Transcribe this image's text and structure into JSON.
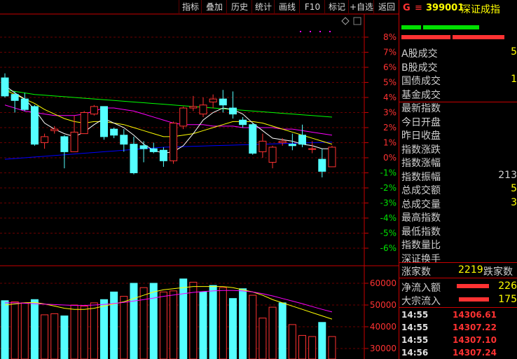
{
  "toolbar": {
    "buttons": [
      "指标",
      "叠加",
      "历史",
      "统计",
      "画线",
      "F10",
      "标记",
      "+自选",
      "返回"
    ]
  },
  "price_panel": {
    "y_ticks": [
      "8%",
      "7%",
      "6%",
      "5%",
      "4%",
      "3%",
      "2%",
      "1%",
      "0%",
      "-1%",
      "-2%",
      "-3%",
      "-4%",
      "-5%",
      "-6%"
    ],
    "colors": {
      "up": "#ff3232",
      "down": "#54ffff",
      "ma5": "#ffffff",
      "ma10": "#ffff00",
      "ma20": "#ff00ff",
      "ma60": "#00ff00",
      "ma120": "#0000ff",
      "axis": "#c80000"
    },
    "candles": [
      {
        "o": 5.3,
        "c": 4.1,
        "h": 5.6,
        "l": 4.0
      },
      {
        "o": 4.2,
        "c": 3.8,
        "h": 4.4,
        "l": 3.0
      },
      {
        "o": 3.9,
        "c": 3.2,
        "h": 4.3,
        "l": 3.1
      },
      {
        "o": 3.4,
        "c": 0.9,
        "h": 3.5,
        "l": 0.8
      },
      {
        "o": 1.0,
        "c": 1.4,
        "h": 1.6,
        "l": 0.6
      },
      {
        "o": 1.8,
        "c": 1.9,
        "h": 2.1,
        "l": 1.6
      },
      {
        "o": 1.4,
        "c": 0.4,
        "h": 1.5,
        "l": -0.7
      },
      {
        "o": 0.4,
        "c": 1.7,
        "h": 2.8,
        "l": 0.4
      },
      {
        "o": 1.6,
        "c": 3.0,
        "h": 3.1,
        "l": 1.6
      },
      {
        "o": 2.9,
        "c": 3.4,
        "h": 3.5,
        "l": 2.8
      },
      {
        "o": 3.4,
        "c": 1.4,
        "h": 3.4,
        "l": 1.2
      },
      {
        "o": 1.9,
        "c": 1.5,
        "h": 2.0,
        "l": 1.3
      },
      {
        "o": 1.5,
        "c": 0.9,
        "h": 1.9,
        "l": 0.4
      },
      {
        "o": 0.9,
        "c": -1.0,
        "h": 1.4,
        "l": -1.1
      },
      {
        "o": 0.8,
        "c": 0.6,
        "h": 1.1,
        "l": -0.3
      },
      {
        "o": 0.6,
        "c": 0.4,
        "h": 1.0,
        "l": 0.3
      },
      {
        "o": 0.5,
        "c": -0.2,
        "h": 0.7,
        "l": -0.6
      },
      {
        "o": -0.2,
        "c": 2.3,
        "h": 2.4,
        "l": -0.4
      },
      {
        "o": 2.1,
        "c": 3.3,
        "h": 3.4,
        "l": 1.9
      },
      {
        "o": 3.3,
        "c": 3.4,
        "h": 4.1,
        "l": 3.1
      },
      {
        "o": 2.9,
        "c": 3.5,
        "h": 4.0,
        "l": 2.7
      },
      {
        "o": 3.7,
        "c": 3.9,
        "h": 4.2,
        "l": 3.3
      },
      {
        "o": 3.9,
        "c": 3.5,
        "h": 4.5,
        "l": 3.0
      },
      {
        "o": 3.3,
        "c": 2.9,
        "h": 4.4,
        "l": 2.6
      },
      {
        "o": 2.5,
        "c": 2.2,
        "h": 2.7,
        "l": 2.0
      },
      {
        "o": 2.2,
        "c": 0.3,
        "h": 2.3,
        "l": 0.2
      },
      {
        "o": 0.4,
        "c": 1.1,
        "h": 1.6,
        "l": 0.0
      },
      {
        "o": -0.3,
        "c": 0.7,
        "h": 0.8,
        "l": -0.7
      },
      {
        "o": 1.0,
        "c": 1.1,
        "h": 1.3,
        "l": 0.8
      },
      {
        "o": 0.9,
        "c": 0.8,
        "h": 1.6,
        "l": 0.5
      },
      {
        "o": 1.5,
        "c": 0.9,
        "h": 2.2,
        "l": 0.7
      },
      {
        "o": 0.6,
        "c": 0.6,
        "h": 1.1,
        "l": 0.3
      },
      {
        "o": -0.1,
        "c": -0.9,
        "h": 0.6,
        "l": -1.3
      },
      {
        "o": -0.6,
        "c": 0.7,
        "h": 0.8,
        "l": -0.6
      }
    ],
    "ma5": [
      4.8,
      4.3,
      3.9,
      3.2,
      2.3,
      1.9,
      1.6,
      1.4,
      1.7,
      2.2,
      2.6,
      2.3,
      2.0,
      1.5,
      0.9,
      0.5,
      0.3,
      0.4,
      0.8,
      1.6,
      2.5,
      3.0,
      3.3,
      3.2,
      2.9,
      2.3,
      1.8,
      1.3,
      1.2,
      1.1,
      0.9,
      0.8,
      0.6,
      0.6
    ],
    "ma10": [
      4.5,
      4.2,
      3.9,
      3.6,
      3.2,
      2.9,
      2.6,
      2.4,
      2.3,
      2.4,
      2.4,
      2.3,
      2.2,
      2.0,
      1.8,
      1.6,
      1.4,
      1.4,
      1.5,
      1.6,
      1.8,
      2.0,
      2.2,
      2.4,
      2.4,
      2.4,
      2.3,
      2.1,
      1.9,
      1.7,
      1.5,
      1.3,
      1.1,
      0.9
    ],
    "ma20": [
      3.5,
      3.3,
      3.1,
      3.0,
      2.9,
      2.8,
      2.8,
      2.8,
      2.9,
      3.1,
      3.3,
      3.3,
      3.2,
      3.1,
      2.9,
      2.7,
      2.5,
      2.3,
      2.2,
      2.2,
      2.2,
      2.1,
      2.1,
      2.1,
      2.0,
      2.0,
      2.0,
      2.0,
      1.9,
      1.9,
      1.8,
      1.7,
      1.6,
      1.5
    ],
    "ma60": [
      4.5,
      4.4,
      4.3,
      4.2,
      4.15,
      4.1,
      4.05,
      4.0,
      3.95,
      3.9,
      3.85,
      3.8,
      3.75,
      3.7,
      3.65,
      3.6,
      3.55,
      3.5,
      3.45,
      3.4,
      3.35,
      3.3,
      3.25,
      3.2,
      3.15,
      3.1,
      3.05,
      3.0,
      2.95,
      2.9,
      2.85,
      2.8,
      2.75,
      2.7
    ],
    "ma120": [
      -0.1,
      -0.05,
      0.0,
      0.05,
      0.1,
      0.15,
      0.2,
      0.25,
      0.3,
      0.35,
      0.4,
      0.45,
      0.5,
      0.55,
      0.6,
      0.65,
      0.7,
      0.72,
      0.74,
      0.76,
      0.78,
      0.8,
      0.82,
      0.84,
      0.86,
      0.88,
      0.9,
      0.92,
      0.94,
      0.96,
      0.98,
      1.0,
      1.02,
      1.04
    ]
  },
  "volume_panel": {
    "y_ticks": [
      "60000",
      "50000",
      "40000",
      "30000"
    ],
    "bars": [
      {
        "v": 52000,
        "up": false
      },
      {
        "v": 51500,
        "up": true
      },
      {
        "v": 51000,
        "up": true
      },
      {
        "v": 52500,
        "up": false
      },
      {
        "v": 45500,
        "up": true
      },
      {
        "v": 46000,
        "up": true
      },
      {
        "v": 45000,
        "up": false
      },
      {
        "v": 50000,
        "up": true
      },
      {
        "v": 49500,
        "up": true
      },
      {
        "v": 51000,
        "up": true
      },
      {
        "v": 52500,
        "up": false
      },
      {
        "v": 56000,
        "up": false
      },
      {
        "v": 54000,
        "up": true
      },
      {
        "v": 60000,
        "up": false
      },
      {
        "v": 58000,
        "up": true
      },
      {
        "v": 60000,
        "up": false
      },
      {
        "v": 56000,
        "up": true
      },
      {
        "v": 56500,
        "up": true
      },
      {
        "v": 62000,
        "up": false
      },
      {
        "v": 60500,
        "up": true
      },
      {
        "v": 56000,
        "up": false
      },
      {
        "v": 59000,
        "up": false
      },
      {
        "v": 58000,
        "up": true
      },
      {
        "v": 53000,
        "up": false
      },
      {
        "v": 57500,
        "up": false
      },
      {
        "v": 54500,
        "up": true
      },
      {
        "v": 44000,
        "up": true
      },
      {
        "v": 49000,
        "up": true
      },
      {
        "v": 51000,
        "up": false
      },
      {
        "v": 41000,
        "up": true
      },
      {
        "v": 36000,
        "up": true
      },
      {
        "v": 35500,
        "up": true
      },
      {
        "v": 42000,
        "up": false
      },
      {
        "v": 35500,
        "up": true
      }
    ],
    "ma5": [
      50000,
      50500,
      51000,
      51200,
      50500,
      49500,
      48500,
      48000,
      48000,
      48500,
      49500,
      50500,
      51500,
      53000,
      54500,
      56000,
      57000,
      57500,
      58000,
      58500,
      58500,
      58500,
      58500,
      58000,
      57000,
      56000,
      54500,
      52500,
      51000,
      49500,
      48000,
      46500,
      45000,
      43500
    ],
    "ma10": [
      51000,
      51000,
      50800,
      50600,
      50400,
      50200,
      50000,
      49800,
      49800,
      50000,
      50300,
      50700,
      51200,
      51800,
      52500,
      53200,
      54000,
      54600,
      55200,
      55800,
      56200,
      56500,
      56700,
      56700,
      56500,
      56000,
      55200,
      54200,
      53000,
      51800,
      50600,
      49300,
      48000,
      46800
    ]
  },
  "quote_panel": {
    "header": {
      "g": "G",
      "menu": "≡",
      "code": "399001",
      "name": "深证成指"
    },
    "rows": [
      {
        "label": "A股成交",
        "value": "5"
      },
      {
        "label": "B股成交",
        "value": ""
      },
      {
        "label": "国债成交",
        "value": "1"
      },
      {
        "label": "基金成交",
        "value": ""
      },
      {
        "label": "最新指数",
        "value": ""
      },
      {
        "label": "今日开盘",
        "value": ""
      },
      {
        "label": "昨日收盘",
        "value": ""
      },
      {
        "label": "指数涨跌",
        "value": ""
      },
      {
        "label": "指数涨幅",
        "value": ""
      },
      {
        "label": "指数振幅",
        "value": "213"
      },
      {
        "label": "总成交额",
        "value": "5"
      },
      {
        "label": "总成交量",
        "value": "3"
      },
      {
        "label": "最高指数",
        "value": ""
      },
      {
        "label": "最低指数",
        "value": ""
      },
      {
        "label": "指数量比",
        "value": ""
      },
      {
        "label": "深证换手",
        "value": ""
      }
    ],
    "breadth": {
      "up_label": "涨家数",
      "up_value": "2219",
      "down_label": "跌家数"
    },
    "flows": [
      {
        "label": "净流入额",
        "value": "226"
      },
      {
        "label": "大宗流入",
        "value": "175"
      }
    ],
    "ticks": [
      {
        "time": "14:55",
        "price": "14306.61"
      },
      {
        "time": "14:55",
        "price": "14307.22"
      },
      {
        "time": "14:55",
        "price": "14307.10"
      },
      {
        "time": "14:56",
        "price": "14307.24"
      }
    ]
  }
}
